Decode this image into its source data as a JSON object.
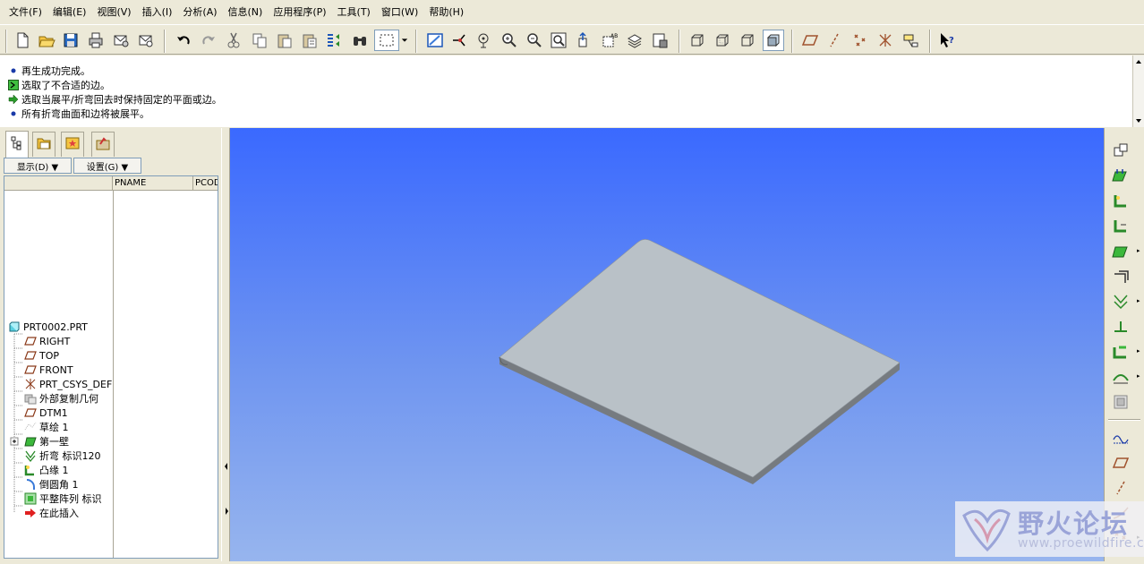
{
  "menubar": {
    "items": [
      "文件(F)",
      "编辑(E)",
      "视图(V)",
      "插入(I)",
      "分析(A)",
      "信息(N)",
      "应用程序(P)",
      "工具(T)",
      "窗口(W)",
      "帮助(H)"
    ]
  },
  "messages": [
    {
      "icon": "info-bullet-icon",
      "text": "再生成功完成。"
    },
    {
      "icon": "select-warning-icon",
      "text": "选取了不合适的边。"
    },
    {
      "icon": "prompt-arrow-icon",
      "text": "选取当展平/折弯回去时保持固定的平面或边。"
    },
    {
      "icon": "info-bullet-icon",
      "text": "所有折弯曲面和边将被展平。"
    }
  ],
  "panel": {
    "show_label": "显示(D) ▼",
    "settings_label": "设置(G) ▼",
    "columns": [
      "",
      "PNAME",
      "PCOD"
    ]
  },
  "tree": {
    "items": [
      {
        "label": "PRT0002.PRT",
        "icon": "part-icon"
      },
      {
        "label": "RIGHT",
        "icon": "datum-plane-icon"
      },
      {
        "label": "TOP",
        "icon": "datum-plane-icon"
      },
      {
        "label": "FRONT",
        "icon": "datum-plane-icon"
      },
      {
        "label": "PRT_CSYS_DEF",
        "icon": "csys-icon"
      },
      {
        "label": "外部复制几何",
        "icon": "external-copy-geom-icon"
      },
      {
        "label": "DTM1",
        "icon": "datum-plane-icon"
      },
      {
        "label": "草绘 1",
        "icon": "sketch-icon"
      },
      {
        "label": "第一壁",
        "icon": "first-wall-icon"
      },
      {
        "label": "折弯 标识120",
        "icon": "bend-icon"
      },
      {
        "label": "凸缘 1",
        "icon": "flange-icon"
      },
      {
        "label": "倒圆角 1",
        "icon": "round-icon"
      },
      {
        "label": "平整阵列 标识",
        "icon": "flat-pattern-icon"
      },
      {
        "label": "在此插入",
        "icon": "insert-here-arrow-icon"
      }
    ]
  },
  "watermark": {
    "title": "野火论坛",
    "url": "www.proewildfire.cn"
  },
  "colors": {
    "viewport_top": "#3a69ff",
    "viewport_bottom": "#97b5ee",
    "plate_top": "#b9c1c7",
    "plate_edge": "#767b80",
    "panel_bg": "#ece9d8"
  }
}
